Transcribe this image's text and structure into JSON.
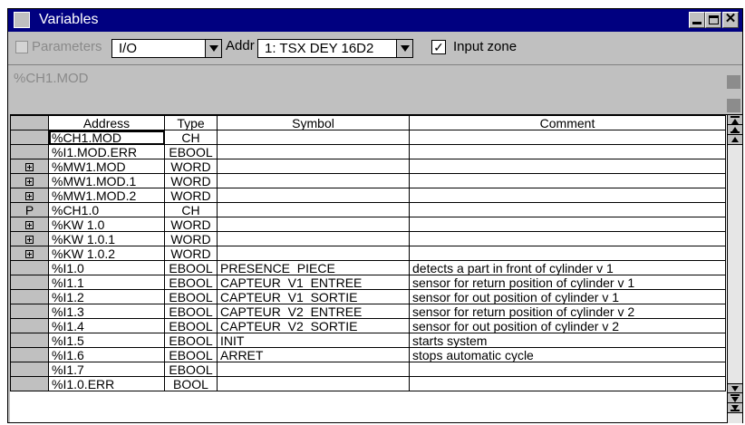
{
  "window": {
    "title": "Variables"
  },
  "toolbar": {
    "parameters_label": "Parameters",
    "parameters_checked": false,
    "io_value": "I/O",
    "addr_label": "Addr",
    "addr_value": "1: TSX DEY 16D2",
    "input_zone_label": "Input zone",
    "input_zone_checked": true,
    "input_zone_mark": "✓"
  },
  "selected_name": "%CH1.MOD",
  "grid": {
    "columns": {
      "address": "Address",
      "type": "Type",
      "symbol": "Symbol",
      "comment": "Comment"
    },
    "rows": [
      {
        "marker": "",
        "address": "%CH1.MOD",
        "type": "CH",
        "symbol": "",
        "comment": ""
      },
      {
        "marker": "",
        "address": "%I1.MOD.ERR",
        "type": "EBOOL",
        "symbol": "",
        "comment": ""
      },
      {
        "marker": "expand",
        "address": "%MW1.MOD",
        "type": "WORD",
        "symbol": "",
        "comment": ""
      },
      {
        "marker": "expand",
        "address": "%MW1.MOD.1",
        "type": "WORD",
        "symbol": "",
        "comment": ""
      },
      {
        "marker": "expand",
        "address": "%MW1.MOD.2",
        "type": "WORD",
        "symbol": "",
        "comment": ""
      },
      {
        "marker": "P",
        "address": "%CH1.0",
        "type": "CH",
        "symbol": "",
        "comment": ""
      },
      {
        "marker": "expand",
        "address": "%KW 1.0",
        "type": "WORD",
        "symbol": "",
        "comment": ""
      },
      {
        "marker": "expand",
        "address": "%KW 1.0.1",
        "type": "WORD",
        "symbol": "",
        "comment": ""
      },
      {
        "marker": "expand",
        "address": "%KW 1.0.2",
        "type": "WORD",
        "symbol": "",
        "comment": ""
      },
      {
        "marker": "",
        "address": "%I1.0",
        "type": "EBOOL",
        "symbol": "PRESENCE_PIECE",
        "comment": "detects a part in front of cylinder v 1"
      },
      {
        "marker": "",
        "address": "%I1.1",
        "type": "EBOOL",
        "symbol": "CAPTEUR_V1_ENTREE",
        "comment": "sensor for return position of cylinder v 1"
      },
      {
        "marker": "",
        "address": "%I1.2",
        "type": "EBOOL",
        "symbol": "CAPTEUR_V1_SORTIE",
        "comment": "sensor for out position of cylinder v 1"
      },
      {
        "marker": "",
        "address": "%I1.3",
        "type": "EBOOL",
        "symbol": "CAPTEUR_V2_ENTREE",
        "comment": "sensor for return position of cylinder v 2"
      },
      {
        "marker": "",
        "address": "%I1.4",
        "type": "EBOOL",
        "symbol": "CAPTEUR_V2_SORTIE",
        "comment": "sensor for out position of cylinder v 2"
      },
      {
        "marker": "",
        "address": "%I1.5",
        "type": "EBOOL",
        "symbol": "INIT",
        "comment": "starts system"
      },
      {
        "marker": "",
        "address": "%I1.6",
        "type": "EBOOL",
        "symbol": "ARRET",
        "comment": "stops automatic cycle"
      },
      {
        "marker": "",
        "address": "%I1.7",
        "type": "EBOOL",
        "symbol": "",
        "comment": ""
      },
      {
        "marker": "",
        "address": "%I1.0.ERR",
        "type": "BOOL",
        "symbol": "",
        "comment": ""
      }
    ]
  }
}
